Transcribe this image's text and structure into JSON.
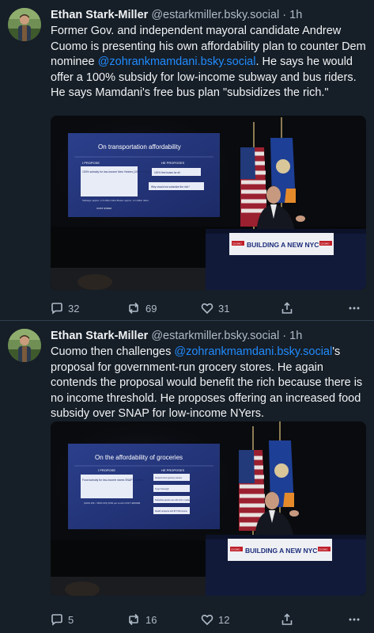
{
  "posts": [
    {
      "author_name": "Ethan Stark-Miller",
      "handle": "@estarkmiller.bsky.social",
      "separator": "·",
      "time": "1h",
      "text_before": "Former Gov. and independent mayoral candidate Andrew Cuomo is presenting his own affordability plan to counter Dem nominee ",
      "mention": "@zohrankmamdani.bsky.social",
      "text_after": ". He says he would offer a 100% subsidy for low-income subway and bus riders. He says Mamdani's free bus plan \"subsidizes the rich.\"",
      "image": {
        "slide_title": "On transportation affordability",
        "left_header": "I PROPOSE",
        "left_box": "100% subsidy for low-income New Yorkers (100% FPL) on both buses and subways",
        "left_note": "Subways: approx. 2.4 million riders\nBuses: approx. 1.4 million riders",
        "left_cost": "COST: $700M",
        "right_header": "HE PROPOSES",
        "right_box1": "100% free buses for all",
        "right_box2": "Why should we subsidize the rich?",
        "podium_sign": "BUILDING A NEW NYC",
        "podium_logo": "CUOMO"
      },
      "replies": "32",
      "reposts": "69",
      "likes": "31"
    },
    {
      "author_name": "Ethan Stark-Miller",
      "handle": "@estarkmiller.bsky.social",
      "separator": "·",
      "time": "1h",
      "text_before": "Cuomo then challenges ",
      "mention": "@zohrankmamdani.bsky.social",
      "text_after": "'s proposal for government-run grocery stores. He again contends the proposal would benefit the rich because there is no income threshold. He proposes offering an increased food subsidy over SNAP for low-income NYers.",
      "image": {
        "slide_title": "On the affordability of groceries",
        "left_header": "I PROPOSE",
        "left_box": "Food subsidy for low-income stores SNAP eligibility",
        "left_note": "(100% FPL / 150% FPL)\n$700 per month\nCOST: $300MM",
        "right_header": "HE PROPOSES",
        "right_box1": "Government grocery stores",
        "right_box2": "5 per borough",
        "right_box3": "Subsidizes goods even with rich in markets",
        "right_box4": "Wealth recipients with $77,000 income",
        "podium_sign": "BUILDING A NEW NYC",
        "podium_logo": "CUOMO"
      },
      "replies": "5",
      "reposts": "16",
      "likes": "12"
    }
  ],
  "colors": {
    "background": "#161e27",
    "text": "#f1f3f5",
    "muted": "#aebbc9",
    "link": "#208bfe",
    "divider": "#2e4052"
  }
}
